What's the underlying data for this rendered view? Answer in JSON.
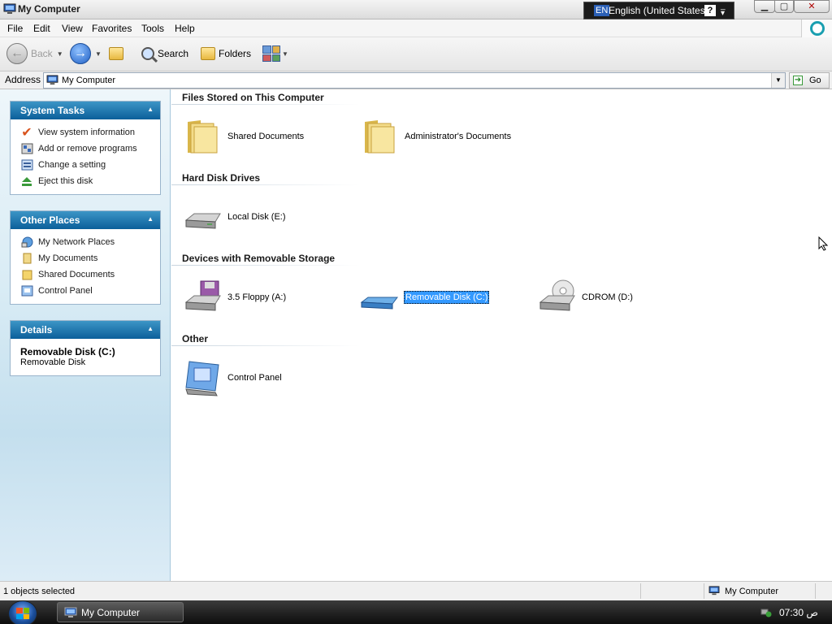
{
  "window": {
    "title": "My Computer"
  },
  "langbar": {
    "code": "EN",
    "language": "English (United States)",
    "help": "?"
  },
  "menu": [
    "File",
    "Edit",
    "View",
    "Favorites",
    "Tools",
    "Help"
  ],
  "toolbar": {
    "back_label": "Back",
    "search_label": "Search",
    "folders_label": "Folders"
  },
  "address": {
    "label": "Address",
    "value": "My Computer",
    "go_label": "Go"
  },
  "sidebar": {
    "system_tasks": {
      "title": "System Tasks",
      "items": [
        {
          "label": "View system information",
          "icon": "checkmark-icon"
        },
        {
          "label": "Add or remove programs",
          "icon": "programs-icon"
        },
        {
          "label": "Change a setting",
          "icon": "settings-icon"
        },
        {
          "label": "Eject this disk",
          "icon": "eject-icon"
        }
      ]
    },
    "other_places": {
      "title": "Other Places",
      "items": [
        {
          "label": "My Network Places",
          "icon": "network-icon"
        },
        {
          "label": "My Documents",
          "icon": "documents-icon"
        },
        {
          "label": "Shared Documents",
          "icon": "folder-icon"
        },
        {
          "label": "Control Panel",
          "icon": "control-panel-icon"
        }
      ]
    },
    "details": {
      "title": "Details",
      "name": "Removable Disk (C:)",
      "type": "Removable Disk"
    }
  },
  "main": {
    "groups": [
      {
        "title": "Files Stored on This Computer",
        "items": [
          {
            "label": "Shared Documents",
            "icon": "folder-icon"
          },
          {
            "label": "Administrator's Documents",
            "icon": "folder-icon"
          }
        ]
      },
      {
        "title": "Hard Disk Drives",
        "items": [
          {
            "label": "Local Disk (E:)",
            "icon": "hard-disk-icon"
          }
        ]
      },
      {
        "title": "Devices with Removable Storage",
        "items": [
          {
            "label": "3.5 Floppy (A:)",
            "icon": "floppy-drive-icon"
          },
          {
            "label": "Removable Disk (C:)",
            "icon": "removable-disk-icon",
            "selected": true
          },
          {
            "label": "CDROM (D:)",
            "icon": "cdrom-icon"
          }
        ]
      },
      {
        "title": "Other",
        "items": [
          {
            "label": "Control Panel",
            "icon": "control-panel-icon"
          }
        ]
      }
    ]
  },
  "status": {
    "selection": "1 objects selected",
    "zone": "My Computer"
  },
  "taskbar": {
    "task_label": "My Computer",
    "time": "07:30 ص"
  }
}
